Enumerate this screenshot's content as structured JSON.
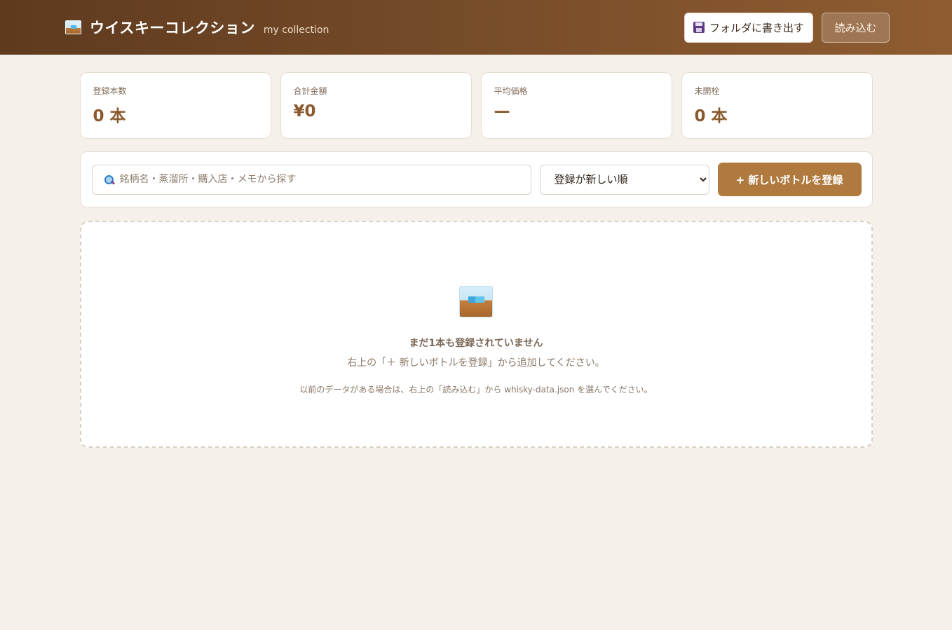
{
  "header": {
    "title": "ウイスキーコレクション",
    "subtitle": "my collection",
    "export_label": "フォルダに書き出す",
    "import_label": "読み込む"
  },
  "stats": [
    {
      "label": "登録本数",
      "value": "0 本"
    },
    {
      "label": "合計金額",
      "value": "¥0"
    },
    {
      "label": "平均価格",
      "value": "—"
    },
    {
      "label": "未開栓",
      "value": "0 本"
    }
  ],
  "toolbar": {
    "search_placeholder": "銘柄名・蒸溜所・購入店・メモから探す",
    "sort_selected": "登録が新しい順",
    "add_label": "+ 新しいボトルを登録"
  },
  "empty_state": {
    "title": "まだ1本も登録されていません",
    "description": "右上の「＋ 新しいボトルを登録」から追加してください。",
    "note": "以前のデータがある場合は、右上の「読み込む」から whisky-data.json を選んでください。"
  },
  "colors": {
    "header_start": "#5e3a1f",
    "header_end": "#8f5c30",
    "accent": "#b07a3e",
    "background": "#f5f0ea"
  },
  "icons": {
    "brand": "whisky-glass-icon",
    "export": "floppy-disk-icon",
    "search": "magnifier-icon",
    "empty": "whisky-glass-icon"
  }
}
